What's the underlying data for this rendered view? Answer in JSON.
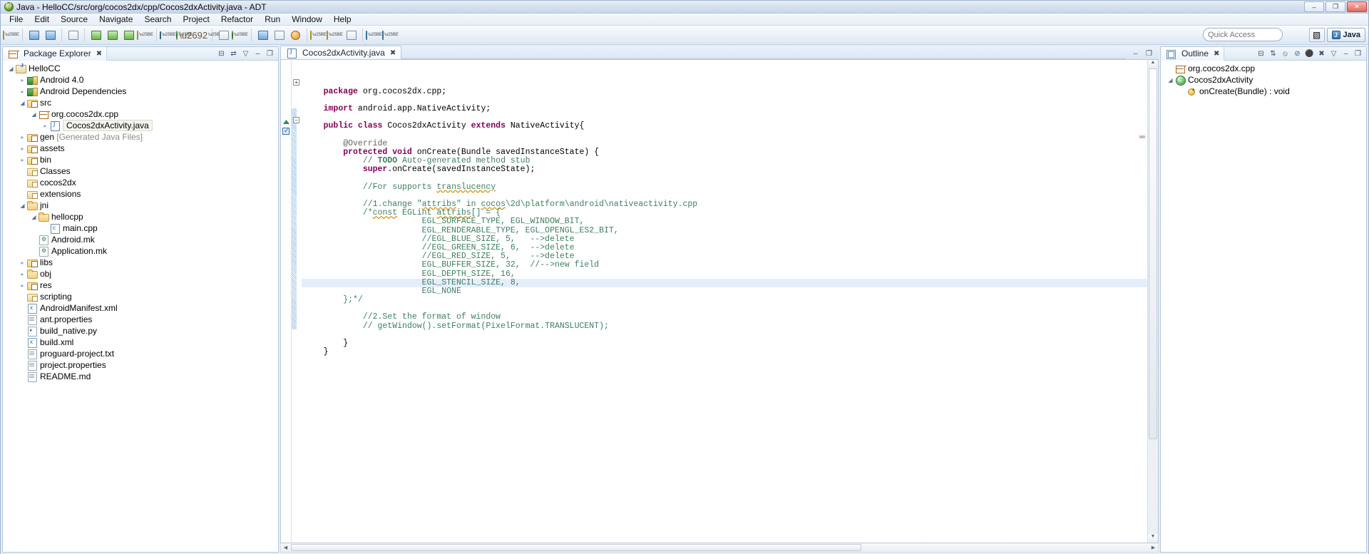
{
  "window": {
    "title": "Java - HelloCC/src/org/cocos2dx/cpp/Cocos2dxActivity.java - ADT",
    "minimize_label": "–",
    "maximize_label": "❐",
    "close_label": "✕"
  },
  "menubar": {
    "items": [
      {
        "label": "File"
      },
      {
        "label": "Edit"
      },
      {
        "label": "Source"
      },
      {
        "label": "Navigate"
      },
      {
        "label": "Search"
      },
      {
        "label": "Project"
      },
      {
        "label": "Refactor"
      },
      {
        "label": "Run"
      },
      {
        "label": "Window"
      },
      {
        "label": "Help"
      }
    ]
  },
  "toolbar": {
    "quick_access_placeholder": "Quick Access",
    "quick_access_value": "",
    "open_perspective_label": "⊞",
    "perspective_label": "Java",
    "buttons": [
      {
        "name": "new-wizard",
        "glyph": "❖"
      },
      {
        "name": "save",
        "glyph": "ὋE"
      },
      {
        "name": "save-all",
        "glyph": "⧉"
      },
      {
        "name": "print",
        "glyph": "⎙"
      },
      {
        "name": "new-android-project",
        "glyph": "▣"
      },
      {
        "name": "android-sdk-manager",
        "glyph": "▤"
      },
      {
        "name": "android-virtual-device-manager",
        "glyph": "▥"
      },
      {
        "name": "lint-warnings",
        "glyph": "⚠"
      },
      {
        "name": "run",
        "glyph": "▶"
      },
      {
        "name": "debug",
        "glyph": "⬤"
      },
      {
        "name": "external-tools",
        "glyph": "⚒"
      },
      {
        "name": "new-java-package",
        "glyph": "⊞"
      },
      {
        "name": "new-java-class",
        "glyph": "C"
      },
      {
        "name": "open-type",
        "glyph": "⌕"
      },
      {
        "name": "toggle-mark-occurrences",
        "glyph": "░"
      },
      {
        "name": "skip-all-breakpoints",
        "glyph": "●"
      },
      {
        "name": "next-annotation",
        "glyph": "↓"
      },
      {
        "name": "previous-annotation",
        "glyph": "↑"
      },
      {
        "name": "last-edit-location",
        "glyph": "✎"
      },
      {
        "name": "back",
        "glyph": "←"
      },
      {
        "name": "forward",
        "glyph": "→"
      }
    ]
  },
  "package_explorer": {
    "title": "Package Explorer",
    "tab_close": "✖",
    "tools": [
      {
        "name": "collapse-all-icon",
        "glyph": "⊟"
      },
      {
        "name": "link-with-editor-icon",
        "glyph": "⇄"
      },
      {
        "name": "view-menu-icon",
        "glyph": "▽"
      },
      {
        "name": "minimize-icon",
        "glyph": "–"
      },
      {
        "name": "maximize-icon",
        "glyph": "❐"
      }
    ],
    "tree": [
      {
        "label": "HelloCC",
        "indent": 0,
        "twist": "open",
        "icon": "project",
        "selected": false
      },
      {
        "label": "Android 4.0",
        "indent": 1,
        "twist": "closed",
        "icon": "lib",
        "selected": false
      },
      {
        "label": "Android Dependencies",
        "indent": 1,
        "twist": "closed",
        "icon": "lib",
        "selected": false
      },
      {
        "label": "src",
        "indent": 1,
        "twist": "open",
        "icon": "srcfolder",
        "selected": false
      },
      {
        "label": "org.cocos2dx.cpp",
        "indent": 2,
        "twist": "open",
        "icon": "pkg",
        "selected": false
      },
      {
        "label": "Cocos2dxActivity.java",
        "indent": 3,
        "twist": "closed",
        "icon": "java",
        "selected": true
      },
      {
        "label": "gen",
        "suffix": " [Generated Java Files]",
        "indent": 1,
        "twist": "closed",
        "icon": "srcfolder",
        "selected": false
      },
      {
        "label": "assets",
        "indent": 1,
        "twist": "closed",
        "icon": "srcfolder",
        "selected": false
      },
      {
        "label": "bin",
        "indent": 1,
        "twist": "closed",
        "icon": "srcfolder",
        "selected": false
      },
      {
        "label": "Classes",
        "indent": 1,
        "twist": "none",
        "icon": "closedfolder",
        "selected": false
      },
      {
        "label": "cocos2dx",
        "indent": 1,
        "twist": "none",
        "icon": "closedfolder",
        "selected": false
      },
      {
        "label": "extensions",
        "indent": 1,
        "twist": "none",
        "icon": "closedfolder",
        "selected": false
      },
      {
        "label": "jni",
        "indent": 1,
        "twist": "open",
        "icon": "folder",
        "selected": false
      },
      {
        "label": "hellocpp",
        "indent": 2,
        "twist": "open",
        "icon": "folder",
        "selected": false
      },
      {
        "label": "main.cpp",
        "indent": 3,
        "twist": "none",
        "icon": "c",
        "selected": false
      },
      {
        "label": "Android.mk",
        "indent": 2,
        "twist": "none",
        "icon": "mk",
        "selected": false
      },
      {
        "label": "Application.mk",
        "indent": 2,
        "twist": "none",
        "icon": "mk",
        "selected": false
      },
      {
        "label": "libs",
        "indent": 1,
        "twist": "closed",
        "icon": "srcfolder",
        "selected": false
      },
      {
        "label": "obj",
        "indent": 1,
        "twist": "closed",
        "icon": "folder",
        "selected": false
      },
      {
        "label": "res",
        "indent": 1,
        "twist": "closed",
        "icon": "srcfolder",
        "selected": false
      },
      {
        "label": "scripting",
        "indent": 1,
        "twist": "none",
        "icon": "closedfolder",
        "selected": false
      },
      {
        "label": "AndroidManifest.xml",
        "indent": 1,
        "twist": "none",
        "icon": "xml",
        "selected": false
      },
      {
        "label": "ant.properties",
        "indent": 1,
        "twist": "none",
        "icon": "file",
        "selected": false
      },
      {
        "label": "build_native.py",
        "indent": 1,
        "twist": "none",
        "icon": "py",
        "selected": false
      },
      {
        "label": "build.xml",
        "indent": 1,
        "twist": "none",
        "icon": "xml",
        "selected": false
      },
      {
        "label": "proguard-project.txt",
        "indent": 1,
        "twist": "none",
        "icon": "file",
        "selected": false
      },
      {
        "label": "project.properties",
        "indent": 1,
        "twist": "none",
        "icon": "file",
        "selected": false
      },
      {
        "label": "README.md",
        "indent": 1,
        "twist": "none",
        "icon": "file",
        "selected": false
      }
    ]
  },
  "editor": {
    "tab_label": "Cocos2dxActivity.java",
    "tab_close": "✖",
    "minimize_label": "–",
    "maximize_label": "❐",
    "lines": [
      {
        "indent": 1,
        "highlight": false,
        "parts": [
          {
            "t": "package",
            "c": "k"
          },
          {
            "t": " org.cocos2dx.cpp;",
            "c": "plain"
          }
        ]
      },
      {
        "indent": 0,
        "highlight": false,
        "parts": []
      },
      {
        "indent": 1,
        "highlight": false,
        "parts": [
          {
            "t": "import",
            "c": "k"
          },
          {
            "t": " android.app.NativeActivity;",
            "c": "plain"
          }
        ]
      },
      {
        "indent": 0,
        "highlight": false,
        "parts": []
      },
      {
        "indent": 1,
        "highlight": false,
        "parts": [
          {
            "t": "public class",
            "c": "k"
          },
          {
            "t": " Cocos2dxActivity ",
            "c": "plain"
          },
          {
            "t": "extends",
            "c": "k"
          },
          {
            "t": " NativeActivity{",
            "c": "plain"
          }
        ]
      },
      {
        "indent": 0,
        "highlight": false,
        "parts": []
      },
      {
        "indent": 2,
        "highlight": false,
        "parts": [
          {
            "t": "@Override",
            "c": "ann"
          }
        ]
      },
      {
        "indent": 2,
        "highlight": false,
        "parts": [
          {
            "t": "protected void",
            "c": "k"
          },
          {
            "t": " onCreate(Bundle savedInstanceState) {",
            "c": "plain"
          }
        ]
      },
      {
        "indent": 3,
        "highlight": false,
        "parts": [
          {
            "t": "// ",
            "c": "cm"
          },
          {
            "t": "TODO",
            "c": "todo"
          },
          {
            "t": " Auto-generated method stub",
            "c": "cm"
          }
        ]
      },
      {
        "indent": 3,
        "highlight": false,
        "parts": [
          {
            "t": "super",
            "c": "k"
          },
          {
            "t": ".onCreate(savedInstanceState);",
            "c": "plain"
          }
        ]
      },
      {
        "indent": 0,
        "highlight": false,
        "parts": []
      },
      {
        "indent": 3,
        "highlight": false,
        "parts": [
          {
            "t": "//For supports ",
            "c": "cm"
          },
          {
            "t": "translucency",
            "c": "cm spell"
          }
        ]
      },
      {
        "indent": 0,
        "highlight": false,
        "parts": []
      },
      {
        "indent": 3,
        "highlight": false,
        "parts": [
          {
            "t": "//1.change \"",
            "c": "cm"
          },
          {
            "t": "attribs",
            "c": "cm spell"
          },
          {
            "t": "\" in ",
            "c": "cm"
          },
          {
            "t": "cocos",
            "c": "cm spell"
          },
          {
            "t": "\\2d\\platform\\android\\nativeactivity.cpp",
            "c": "cm"
          }
        ]
      },
      {
        "indent": 3,
        "highlight": false,
        "parts": [
          {
            "t": "/*",
            "c": "cm"
          },
          {
            "t": "const",
            "c": "cm spell"
          },
          {
            "t": " EGLint ",
            "c": "cm"
          },
          {
            "t": "attribs",
            "c": "cm spell"
          },
          {
            "t": "[] = {",
            "c": "cm"
          }
        ]
      },
      {
        "indent": 6,
        "highlight": false,
        "parts": [
          {
            "t": "EGL_SURFACE_TYPE, EGL_WINDOW_BIT,",
            "c": "cm"
          }
        ]
      },
      {
        "indent": 6,
        "highlight": false,
        "parts": [
          {
            "t": "EGL_RENDERABLE_TYPE, EGL_OPENGL_ES2_BIT,",
            "c": "cm"
          }
        ]
      },
      {
        "indent": 6,
        "highlight": false,
        "parts": [
          {
            "t": "//EGL_BLUE_SIZE, 5,   -->delete",
            "c": "cm"
          }
        ]
      },
      {
        "indent": 6,
        "highlight": false,
        "parts": [
          {
            "t": "//EGL_GREEN_SIZE, 6,  -->delete",
            "c": "cm"
          }
        ]
      },
      {
        "indent": 6,
        "highlight": false,
        "parts": [
          {
            "t": "//EGL_RED_SIZE, 5,    -->delete",
            "c": "cm"
          }
        ]
      },
      {
        "indent": 6,
        "highlight": false,
        "parts": [
          {
            "t": "EGL_BUFFER_SIZE, 32,  //-->new field",
            "c": "cm"
          }
        ]
      },
      {
        "indent": 6,
        "highlight": false,
        "parts": [
          {
            "t": "EGL_DEPTH_SIZE, 16,",
            "c": "cm"
          }
        ]
      },
      {
        "indent": 6,
        "highlight": true,
        "parts": [
          {
            "t": "EGL_STENCIL_SIZE, 8,",
            "c": "cm"
          }
        ]
      },
      {
        "indent": 6,
        "highlight": false,
        "parts": [
          {
            "t": "EGL_NONE",
            "c": "cm"
          }
        ]
      },
      {
        "indent": 2,
        "highlight": false,
        "parts": [
          {
            "t": "};*/",
            "c": "cm"
          }
        ]
      },
      {
        "indent": 0,
        "highlight": false,
        "parts": []
      },
      {
        "indent": 3,
        "highlight": false,
        "parts": [
          {
            "t": "//2.Set the format of window",
            "c": "cm"
          }
        ]
      },
      {
        "indent": 3,
        "highlight": false,
        "parts": [
          {
            "t": "// getWindow().setFormat(PixelFormat.TRANSLUCENT);",
            "c": "cm"
          }
        ]
      },
      {
        "indent": 0,
        "highlight": false,
        "parts": []
      },
      {
        "indent": 2,
        "highlight": false,
        "parts": [
          {
            "t": "}",
            "c": "plain"
          }
        ]
      },
      {
        "indent": 1,
        "highlight": false,
        "parts": [
          {
            "t": "}",
            "c": "plain"
          }
        ]
      }
    ]
  },
  "outline": {
    "title": "Outline",
    "tab_close": "✖",
    "tools": [
      {
        "name": "collapse-all-icon",
        "glyph": "⊟"
      },
      {
        "name": "sort-icon",
        "glyph": "⇅"
      },
      {
        "name": "hide-fields-icon",
        "glyph": "⦸"
      },
      {
        "name": "hide-static-icon",
        "glyph": "⊘"
      },
      {
        "name": "hide-non-public-icon",
        "glyph": "⚫"
      },
      {
        "name": "hide-local-types-icon",
        "glyph": "✖"
      },
      {
        "name": "view-menu-icon",
        "glyph": "▽"
      },
      {
        "name": "minimize-icon",
        "glyph": "–"
      },
      {
        "name": "maximize-icon",
        "glyph": "❐"
      }
    ],
    "items": [
      {
        "label": "org.cocos2dx.cpp",
        "indent": 0,
        "twist": "none",
        "icon": "pkg"
      },
      {
        "label": "Cocos2dxActivity",
        "indent": 0,
        "twist": "open",
        "icon": "class"
      },
      {
        "label": "onCreate(Bundle) : void",
        "indent": 1,
        "twist": "none",
        "icon": "method"
      }
    ]
  }
}
